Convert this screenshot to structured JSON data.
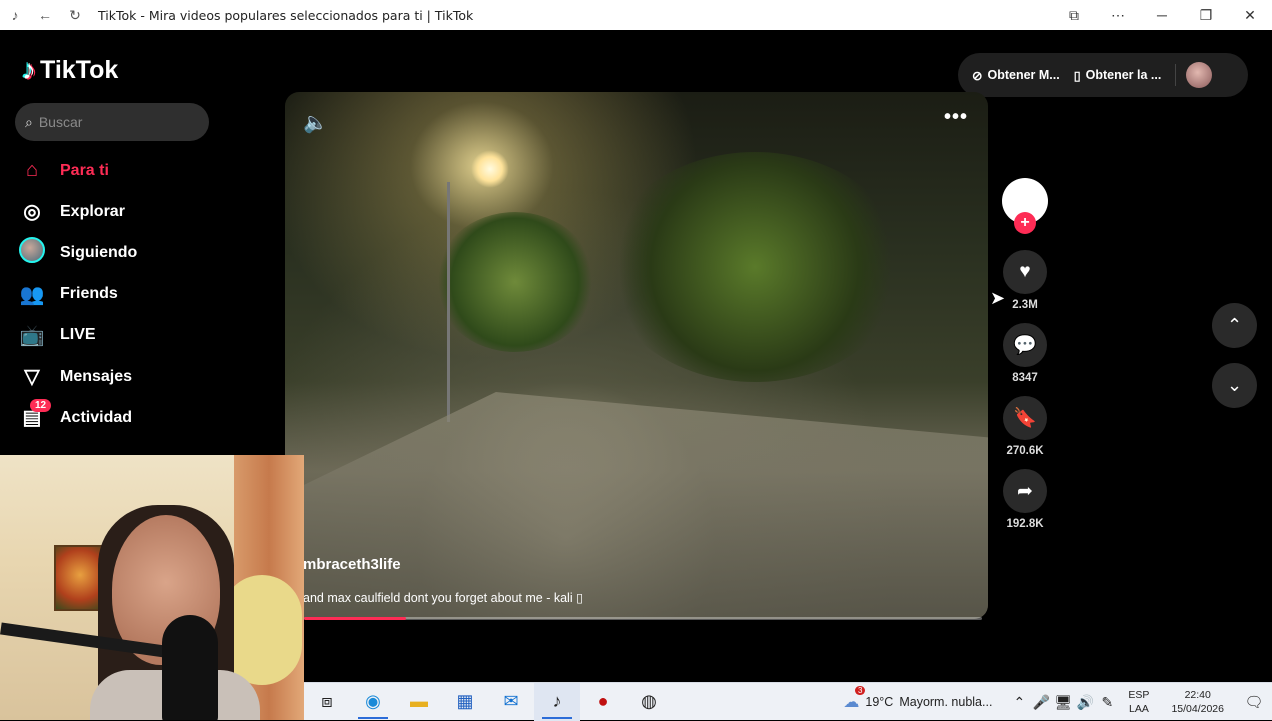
{
  "browser": {
    "title": "TikTok - Mira videos populares seleccionados para ti | TikTok",
    "icons": [
      "tiktok-favicon",
      "back-icon",
      "refresh-icon",
      "split-screen-icon",
      "more-icon",
      "minimize-icon",
      "restore-icon",
      "close-icon"
    ]
  },
  "sidebar": {
    "logo": "TikTok",
    "search_placeholder": "Buscar",
    "items": [
      {
        "label": "Para ti",
        "icon": "home-icon",
        "active": true
      },
      {
        "label": "Explorar",
        "icon": "compass-icon"
      },
      {
        "label": "Siguiendo",
        "icon": "avatar"
      },
      {
        "label": "Friends",
        "icon": "friends-icon"
      },
      {
        "label": "LIVE",
        "icon": "live-icon"
      },
      {
        "label": "Mensajes",
        "icon": "send-icon"
      },
      {
        "label": "Actividad",
        "icon": "inbox-icon",
        "badge": "12"
      }
    ]
  },
  "header": {
    "get_coins": "Obtener M...",
    "get_app": "Obtener la ..."
  },
  "video": {
    "author": "mbraceth3life",
    "caption": "and max caulfield dont you forget about me - kali ▯",
    "progress": 0.15
  },
  "actions": {
    "likes": "2.3M",
    "comments": "8347",
    "saves": "270.6K",
    "shares": "192.8K"
  },
  "taskbar": {
    "weather_temp": "19°C",
    "weather_text": "Mayorm. nubla...",
    "weather_badge": "3",
    "lang_line1": "ESP",
    "lang_line2": "LAA",
    "time": "22:40",
    "date": "15/04/2026"
  },
  "colors": {
    "accent": "#fe2c55",
    "cyan": "#25f4ee",
    "background": "#000000"
  }
}
